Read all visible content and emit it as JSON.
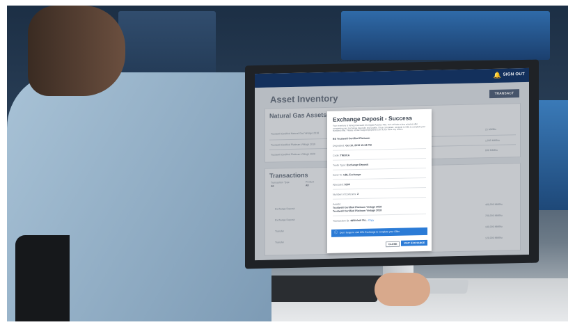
{
  "screen": {
    "topbar": {
      "bell_icon": "bell-icon",
      "signout_label": "SIGN OUT"
    },
    "page_title": "Asset Inventory",
    "transact_button": "TRANSACT",
    "natural_gas": {
      "title": "Natural Gas Assets",
      "rows": [
        "Trustwell Certified Natural Gas Vintage 2018",
        "Trustwell Certified Platinum Vintage 2019",
        "Trustwell Certified Platinum Vintage 2020"
      ],
      "quantities": [
        "21 MMBtu",
        "1,000 MMBtu",
        "600 MMBtu"
      ]
    },
    "transactions": {
      "title": "Transactions",
      "filter_label": "Transaction Type",
      "filter_value": "All",
      "product_label": "Product",
      "product_value": "All",
      "rows": [
        "Exchange Deposit",
        "Exchange Deposit",
        "Transfer",
        "Transfer"
      ],
      "quantities": [
        "400,000 MMBtu",
        "700,000 MMBtu",
        "180,000 MMBtu",
        "120,000 MMBtu"
      ]
    },
    "modal": {
      "title": "Exchange Deposit - Success",
      "body": "Your inventory is being processed into Digital Assets (TNI). This will take a few minutes after completing your Exchange Deposits and update. Once completed, navigate to CBL to complete your standard offer. Please contact support@xpansiv.com if you have any issues.",
      "product": "BS Trustwell Certified Platinum",
      "fields": [
        {
          "label": "Deposited:",
          "value": "Oct 10, 2019 10:24 PM"
        },
        {
          "label": "Code:",
          "value": "TWOCA"
        },
        {
          "label": "Trade Type:",
          "value": "Exchange Deposit"
        },
        {
          "label": "Send To:",
          "value": "CBL Exchange"
        },
        {
          "label": "Allocated:",
          "value": "$300"
        },
        {
          "label": "Number of Contracts:",
          "value": "2"
        }
      ],
      "assets_label": "Assets:",
      "assets": [
        "Trustwell Certified Platinum Vintage 2018",
        "Trustwell Certified Platinum Vintage 2018"
      ],
      "transaction_id_label": "Transaction ID:",
      "transaction_id": "485fc0a8-7f4...",
      "copy_label": "Copy",
      "banner": "Don't forget to visit CBL Exchange to complete your Offer",
      "info_icon": "info-icon",
      "close_label": "CLOSE",
      "visit_label": "VISIT EXCHANGE"
    }
  }
}
